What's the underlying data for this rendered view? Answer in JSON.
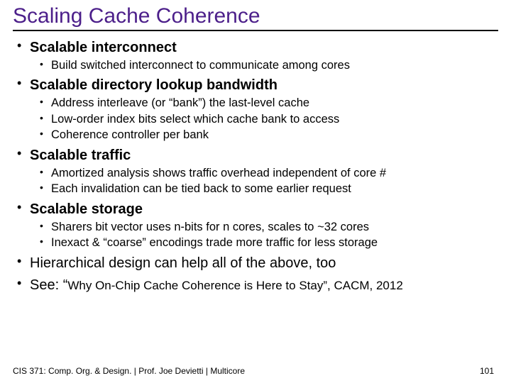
{
  "title": "Scaling Cache Coherence",
  "bullets": {
    "b1": {
      "heading": "Scalable interconnect",
      "s1": "Build switched interconnect to communicate among cores"
    },
    "b2": {
      "heading": "Scalable directory lookup bandwidth",
      "s1": "Address interleave (or “bank”) the last-level cache",
      "s2": "Low-order index bits select which cache bank to access",
      "s3": "Coherence controller per bank"
    },
    "b3": {
      "heading": "Scalable traffic",
      "s1": "Amortized analysis shows traffic overhead independent of core #",
      "s2": "Each invalidation can be tied back to some earlier request"
    },
    "b4": {
      "heading": "Scalable storage",
      "s1": "Sharers bit vector uses n-bits for n cores, scales to ~32 cores",
      "s2": "Inexact & “coarse” encodings trade more traffic for less storage"
    },
    "b5": {
      "heading": "Hierarchical design can help all of the above, too"
    },
    "b6": {
      "prefix": "See: “",
      "ref": "Why On-Chip Cache Coherence is Here to Stay”, CACM, 2012"
    }
  },
  "footer": "CIS 371: Comp. Org. & Design. |  Prof. Joe Devietti  |  Multicore",
  "pagenum": "101"
}
